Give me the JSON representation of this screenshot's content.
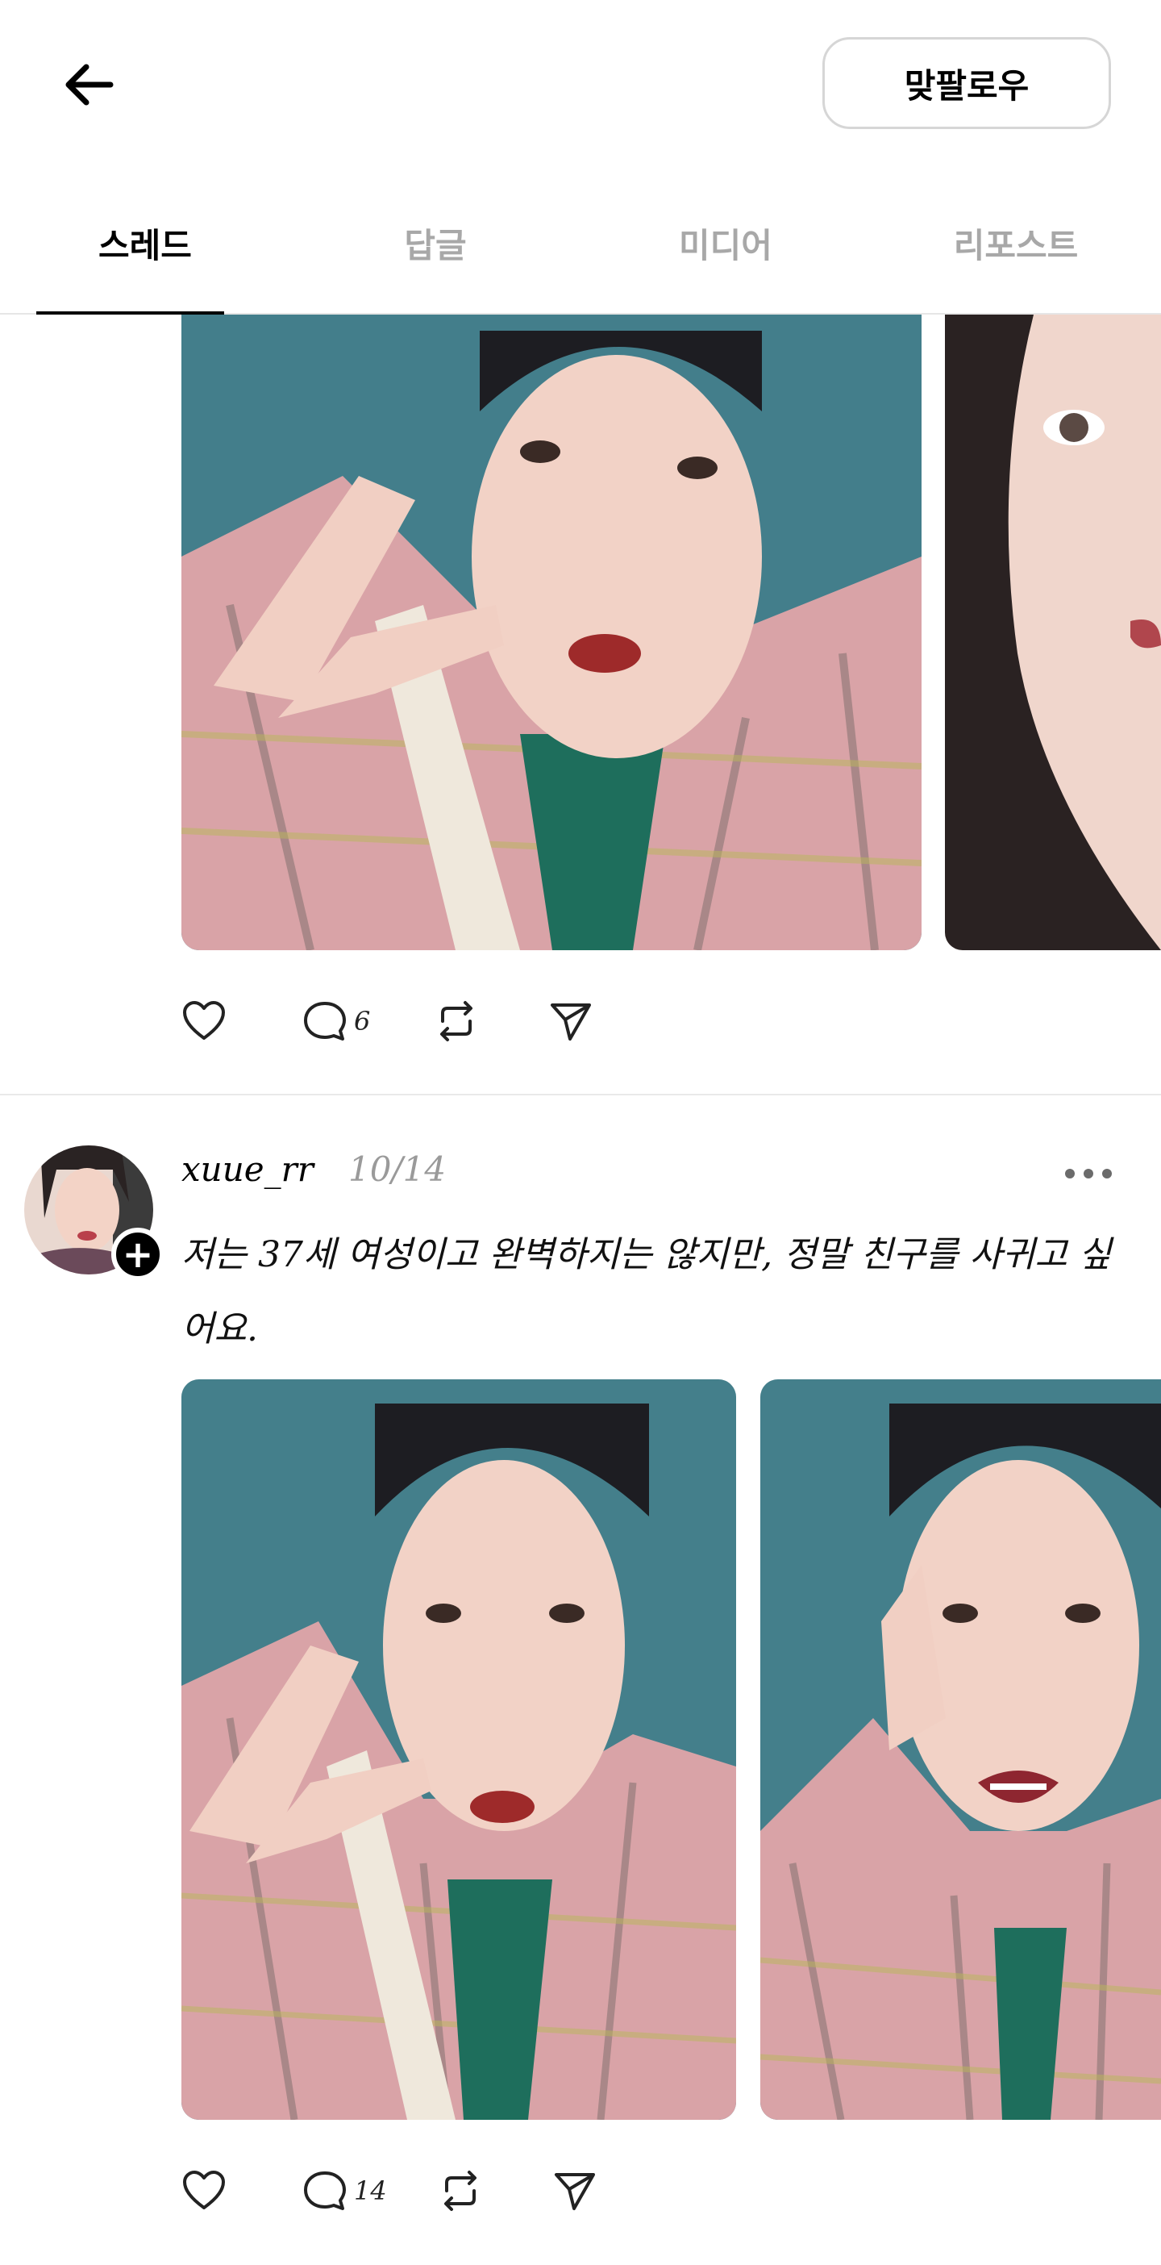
{
  "header": {
    "follow_label": "맞팔로우",
    "back_icon": "arrow-left-icon"
  },
  "tabs": [
    {
      "label": "스레드",
      "active": true
    },
    {
      "label": "답글",
      "active": false
    },
    {
      "label": "미디어",
      "active": false
    },
    {
      "label": "리포스트",
      "active": false
    }
  ],
  "post1": {
    "comments": "6",
    "action_icons": [
      "heart-icon",
      "comment-icon",
      "repost-icon",
      "send-icon"
    ]
  },
  "post2": {
    "username": "xuue_rr",
    "date": "10/14",
    "text": "저는 37세 여성이고 완벽하지는 않지만, 정말 친구를 사귀고 싶어요.",
    "comments": "14"
  },
  "colors": {
    "accent": "#000000",
    "inactive_tab": "#a8a8a8",
    "photo_bg": "#3f7a86",
    "shirt_pink": "#d9a3a7"
  }
}
